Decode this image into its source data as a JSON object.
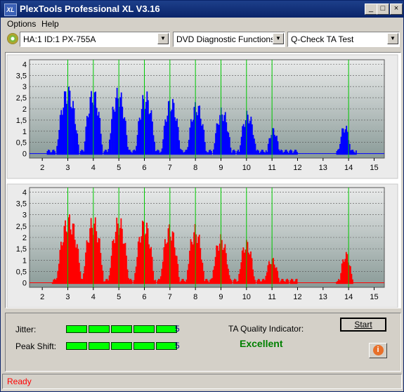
{
  "window": {
    "title": "PlexTools Professional XL V3.16",
    "icon_text": "XL"
  },
  "window_controls": {
    "minimize": "_",
    "maximize": "□",
    "close": "×"
  },
  "menu": {
    "options": "Options",
    "help": "Help"
  },
  "toolbar": {
    "drive": "HA:1 ID:1  PX-755A",
    "function": "DVD Diagnostic Functions",
    "test": "Q-Check TA Test"
  },
  "colors": {
    "top_series": "#0000ff",
    "bottom_series": "#ff0000",
    "marker": "#00c800",
    "excellent": "#008000",
    "value": "#000080"
  },
  "chart_data": [
    {
      "type": "bar",
      "name": "top-histogram",
      "x_ticks": [
        "2",
        "3",
        "4",
        "5",
        "6",
        "7",
        "8",
        "9",
        "10",
        "11",
        "12",
        "13",
        "14",
        "15"
      ],
      "y_ticks": [
        "0",
        "0,5",
        "1",
        "1,5",
        "2",
        "2,5",
        "3",
        "3,5",
        "4"
      ],
      "xlim": [
        1.5,
        15.4
      ],
      "ylim": [
        -0.2,
        4.2
      ],
      "markers": [
        3,
        4,
        5,
        6,
        7,
        8,
        9,
        10,
        11,
        14
      ],
      "peaks": [
        {
          "center": 3.0,
          "height": 3.1,
          "width": 0.45
        },
        {
          "center": 4.0,
          "height": 3.0,
          "width": 0.38
        },
        {
          "center": 4.98,
          "height": 3.0,
          "width": 0.4
        },
        {
          "center": 6.05,
          "height": 2.85,
          "width": 0.4
        },
        {
          "center": 7.05,
          "height": 2.6,
          "width": 0.38
        },
        {
          "center": 8.05,
          "height": 2.4,
          "width": 0.38
        },
        {
          "center": 9.05,
          "height": 2.1,
          "width": 0.36
        },
        {
          "center": 10.05,
          "height": 1.95,
          "width": 0.34
        },
        {
          "center": 11.05,
          "height": 1.2,
          "width": 0.25
        },
        {
          "center": 13.85,
          "height": 1.35,
          "width": 0.25
        }
      ],
      "range": [
        2.2,
        14.3
      ]
    },
    {
      "type": "bar",
      "name": "bottom-histogram",
      "x_ticks": [
        "2",
        "3",
        "4",
        "5",
        "6",
        "7",
        "8",
        "9",
        "10",
        "11",
        "12",
        "13",
        "14",
        "15"
      ],
      "y_ticks": [
        "0",
        "0,5",
        "1",
        "1,5",
        "2",
        "2,5",
        "3",
        "3,5",
        "4"
      ],
      "xlim": [
        1.5,
        15.4
      ],
      "ylim": [
        -0.2,
        4.2
      ],
      "markers": [
        3,
        4,
        5,
        6,
        7,
        8,
        9,
        10,
        11,
        14
      ],
      "peaks": [
        {
          "center": 3.05,
          "height": 3.1,
          "width": 0.5
        },
        {
          "center": 4.0,
          "height": 3.0,
          "width": 0.42
        },
        {
          "center": 5.0,
          "height": 3.0,
          "width": 0.4
        },
        {
          "center": 6.0,
          "height": 2.9,
          "width": 0.4
        },
        {
          "center": 7.0,
          "height": 2.65,
          "width": 0.38
        },
        {
          "center": 8.0,
          "height": 2.6,
          "width": 0.36
        },
        {
          "center": 9.0,
          "height": 2.15,
          "width": 0.36
        },
        {
          "center": 10.0,
          "height": 1.95,
          "width": 0.33
        },
        {
          "center": 11.0,
          "height": 1.15,
          "width": 0.3
        },
        {
          "center": 13.9,
          "height": 1.4,
          "width": 0.26
        }
      ],
      "range": [
        2.4,
        14.2
      ]
    }
  ],
  "results": {
    "jitter_label": "Jitter:",
    "jitter_value": "5",
    "jitter_level": 5,
    "peak_shift_label": "Peak Shift:",
    "peak_shift_value": "5",
    "peak_shift_level": 5,
    "ta_label": "TA Quality Indicator:",
    "ta_value": "Excellent"
  },
  "buttons": {
    "start": "Start",
    "info_icon": "i"
  },
  "status": {
    "text": "Ready"
  }
}
